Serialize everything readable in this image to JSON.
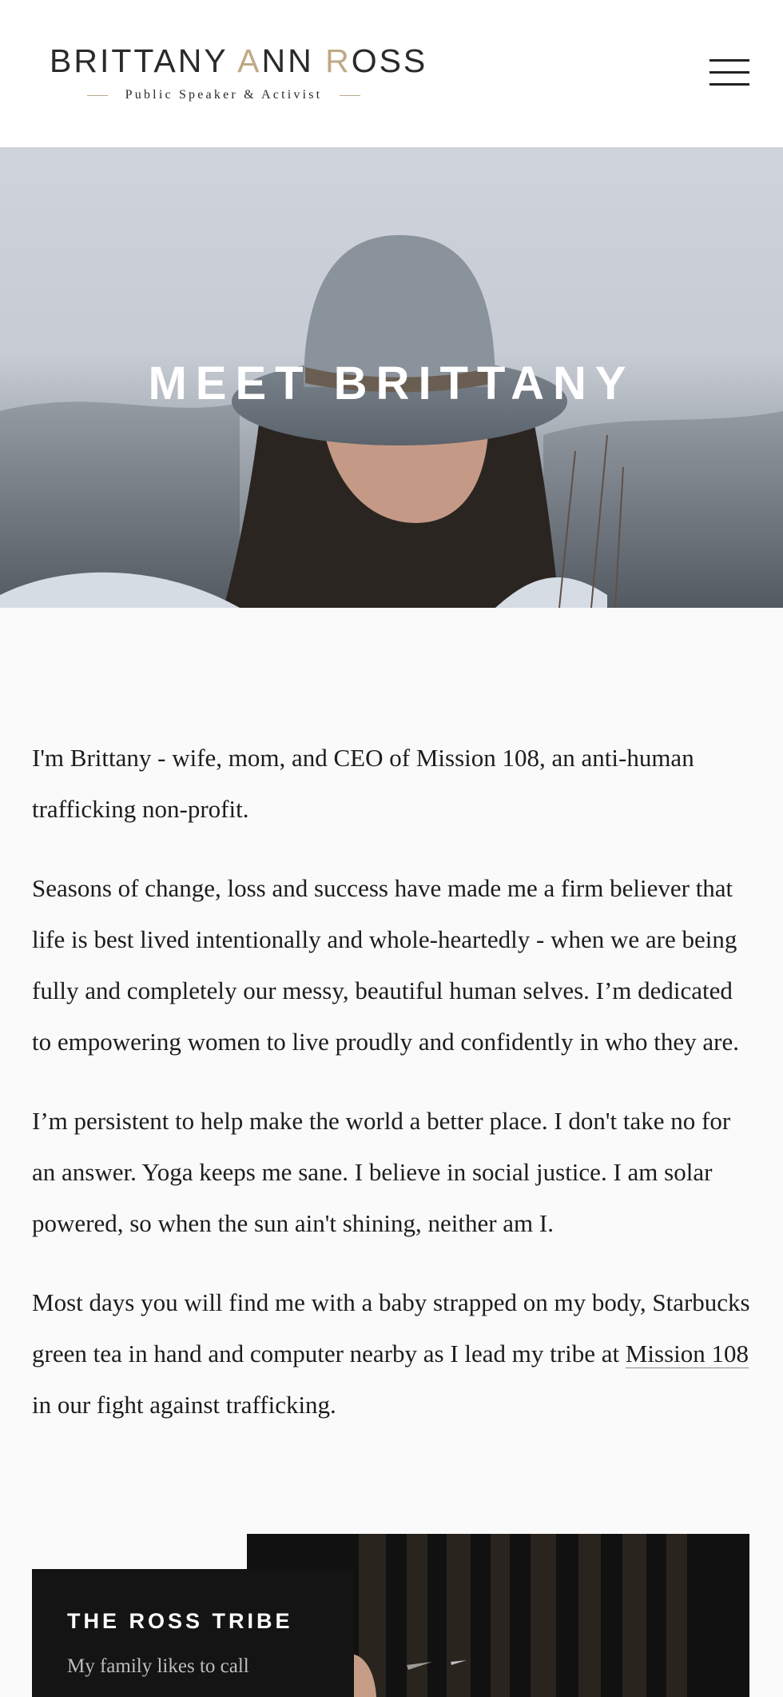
{
  "header": {
    "logo": {
      "name_parts": [
        "B",
        "RITTANY ",
        "A",
        "NN ",
        "R",
        "OSS"
      ],
      "tagline": "Public Speaker & Activist"
    },
    "menu_icon": "hamburger-menu-icon"
  },
  "hero": {
    "title": "MEET BRITTANY"
  },
  "content": {
    "paragraphs": [
      "I'm Brittany - wife, mom, and CEO of Mission 108, an anti-human trafficking non-profit.",
      "Seasons of change, loss and success have made me a firm believer that life is best lived intentionally and whole-heartedly - when we are being fully and completely our messy, beautiful human selves. I’m dedicated to empowering women to live proudly and confidently in who they are.",
      "I’m persistent to help make the world a better place. I don't take no for an answer. Yoga keeps me sane. I believe in social justice. I am solar powered, so when the sun ain't shining, neither am I."
    ],
    "last_paragraph": {
      "before_link": "Most days you will find me with a baby strapped on my body, Starbucks green tea in hand and computer nearby as I lead my tribe at ",
      "link_text": "Mission 108",
      "after_link": " in our fight against trafficking."
    }
  },
  "tribe": {
    "title": "THE ROSS TRIBE",
    "text": "My family likes to call"
  },
  "colors": {
    "accent_gold": "#bfa985",
    "text": "#1d1d1d",
    "background": "#fafafa",
    "card_dark": "#141414"
  }
}
